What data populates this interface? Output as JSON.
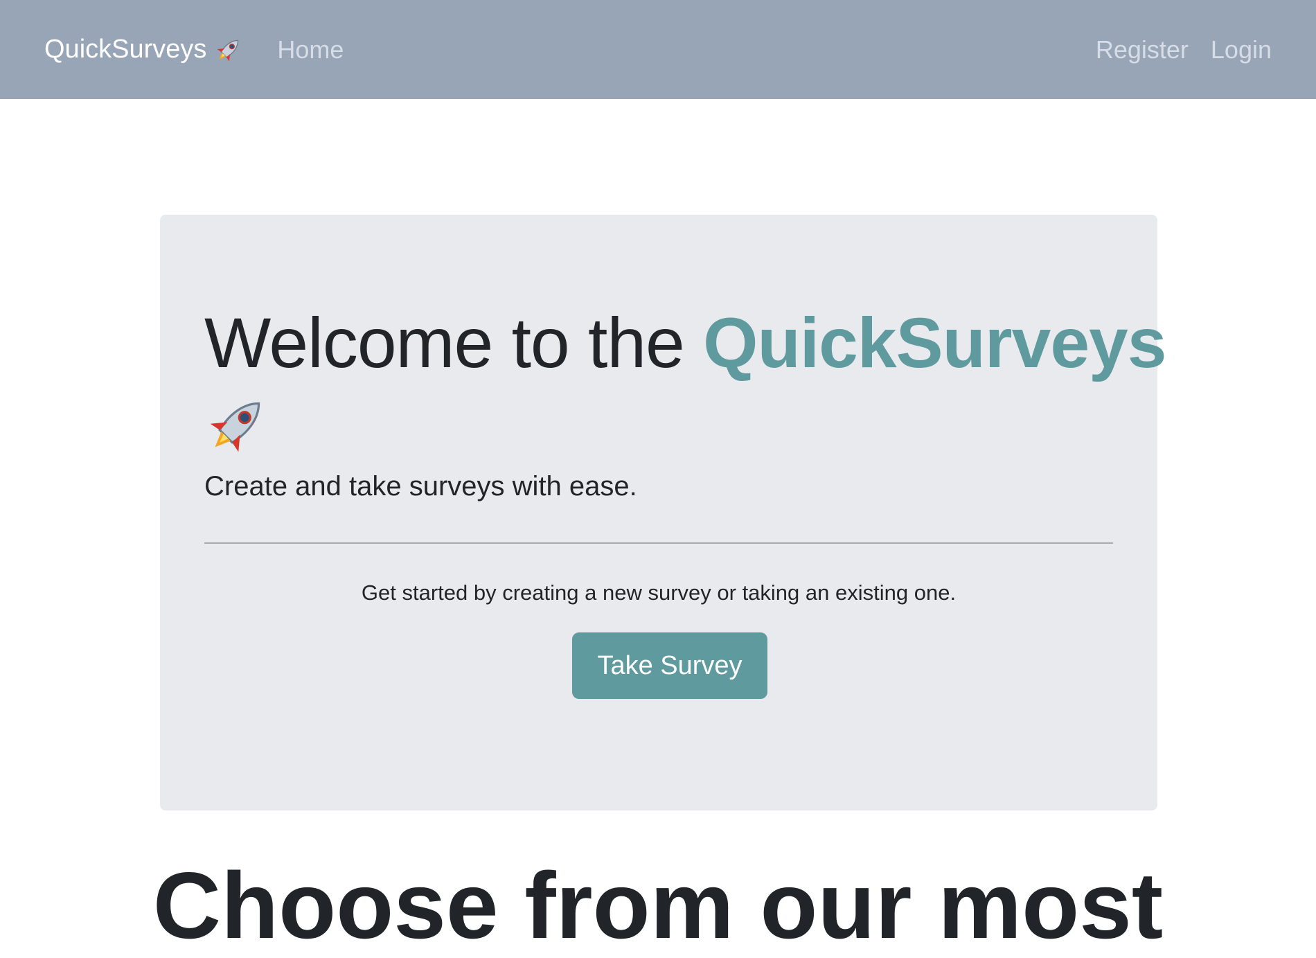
{
  "navbar": {
    "brand": "QuickSurveys",
    "brand_icon": "rocket-icon",
    "home": "Home",
    "register": "Register",
    "login": "Login"
  },
  "hero": {
    "headline_prefix": "Welcome to the ",
    "headline_brand": "QuickSurveys",
    "headline_icon": "rocket-icon",
    "lead": "Create and take surveys with ease.",
    "cta_text": "Get started by creating a new survey or taking an existing one.",
    "button_label": "Take Survey"
  },
  "section": {
    "heading": "Choose from our most"
  },
  "colors": {
    "navbar_bg": "#97a5b7",
    "accent": "#5f9b9e",
    "jumbotron_bg": "#e9eaee"
  }
}
